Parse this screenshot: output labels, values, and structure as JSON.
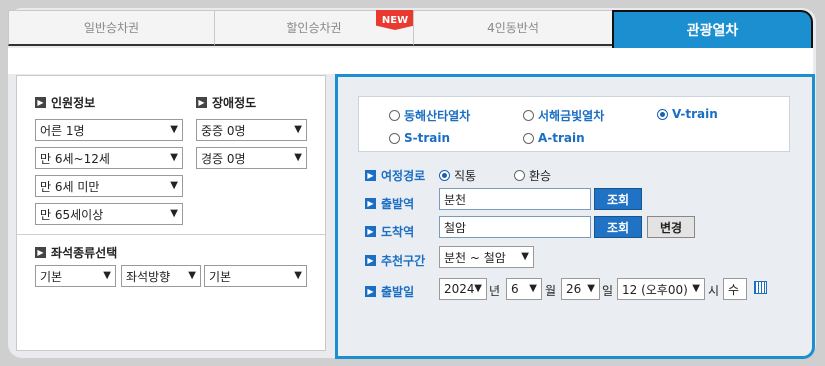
{
  "tabs": [
    {
      "label": "일반승차권"
    },
    {
      "label": "할인승차권",
      "badge": "NEW"
    },
    {
      "label": "4인동반석"
    },
    {
      "label": "관광열차",
      "active": true
    }
  ],
  "passengers": {
    "title": "인원정보",
    "adult": "어른 1명",
    "child": "만 6세~12세",
    "infant": "만 6세 미만",
    "senior": "만 65세이상"
  },
  "disability": {
    "title": "장애정도",
    "severe": "중증 0명",
    "mild": "경증 0명"
  },
  "seat_type": {
    "title": "좌석종류선택",
    "type": "기본",
    "direction": "좌석방향",
    "option": "기본"
  },
  "trains": [
    {
      "label": "동해산타열차",
      "selected": false
    },
    {
      "label": "서해금빛열차",
      "selected": false
    },
    {
      "label": "V-train",
      "selected": true
    },
    {
      "label": "S-train",
      "selected": false
    },
    {
      "label": "A-train",
      "selected": false
    }
  ],
  "route": {
    "label": "여정경로",
    "direct": "직통",
    "transfer": "환승",
    "selected": "직통"
  },
  "departure": {
    "label": "출발역",
    "value": "분천",
    "button": "조회"
  },
  "arrival": {
    "label": "도착역",
    "value": "철암",
    "button": "조회",
    "swap": "변경"
  },
  "recommended": {
    "label": "추천구간",
    "value": "분천 ~ 철암"
  },
  "date": {
    "label": "출발일",
    "year": "2024",
    "year_unit": "년",
    "month": "6",
    "month_unit": "월",
    "day": "26",
    "day_unit": "일",
    "hour": "12 (오후00)",
    "hour_unit": "시",
    "weekday": "수"
  },
  "colors": {
    "accent": "#1b8fd0",
    "label_blue": "#1a6ec4",
    "button_blue": "#1f72c4",
    "badge_red": "#e83a30"
  }
}
